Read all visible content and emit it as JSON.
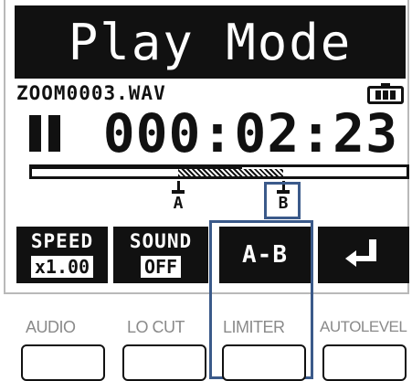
{
  "screen": {
    "title": "Play Mode",
    "file_name": "ZOOM0003.WAV",
    "time": "000:02:23",
    "progress": {
      "played_fraction": 0.56,
      "section_start_fraction": 0.39,
      "section_end_fraction": 0.67,
      "marker_a_label": "A",
      "marker_b_label": "B"
    },
    "functions": [
      {
        "top": "SPEED",
        "bottom": "x1.00"
      },
      {
        "top": "SOUND",
        "bottom": "OFF"
      },
      {
        "label": "A-B"
      },
      {
        "icon": "return-icon"
      }
    ]
  },
  "hardware_buttons": [
    {
      "label": "AUDIO"
    },
    {
      "label": "LO CUT"
    },
    {
      "label": "LIMITER"
    },
    {
      "label": "AUTOLEVEL"
    }
  ],
  "colors": {
    "display_dark": "#111111",
    "highlight": "#3b5a8a",
    "label_gray": "#8a8a8a"
  }
}
